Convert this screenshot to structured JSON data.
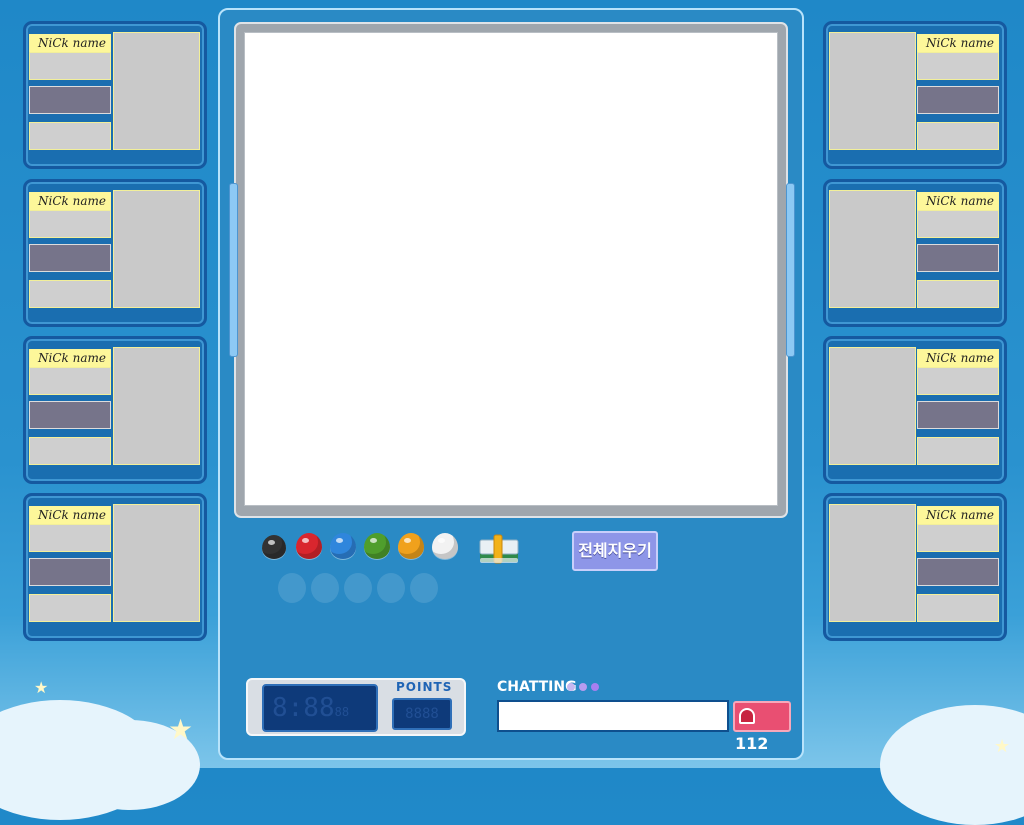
{
  "left_players": [
    {
      "nick_label": "NiCk name"
    },
    {
      "nick_label": "NiCk name"
    },
    {
      "nick_label": "NiCk name"
    },
    {
      "nick_label": "NiCk name"
    }
  ],
  "right_players": [
    {
      "nick_label": "NiCk name"
    },
    {
      "nick_label": "NiCk name"
    },
    {
      "nick_label": "NiCk name"
    },
    {
      "nick_label": "NiCk name"
    }
  ],
  "palette": {
    "colors": [
      {
        "name": "black",
        "hex": "#333333"
      },
      {
        "name": "red",
        "hex": "#d9262e"
      },
      {
        "name": "blue",
        "hex": "#2f86dc"
      },
      {
        "name": "green",
        "hex": "#4f9e2c"
      },
      {
        "name": "orange",
        "hex": "#f0a11c"
      },
      {
        "name": "white",
        "hex": "#f2f2f2"
      }
    ],
    "eraser_icon": "eraser-icon"
  },
  "toolbar": {
    "clear_all_label": "전체지우기"
  },
  "status": {
    "timer": "8:88",
    "timer_small": "88",
    "points_label": "POINTS",
    "points_value": "8888"
  },
  "chat": {
    "label": "CHATTING",
    "input_value": "",
    "dot_colors": [
      "#c6b8f0",
      "#b79cf0",
      "#a77ff0"
    ]
  },
  "report": {
    "icon": "siren-icon",
    "count": "112"
  }
}
